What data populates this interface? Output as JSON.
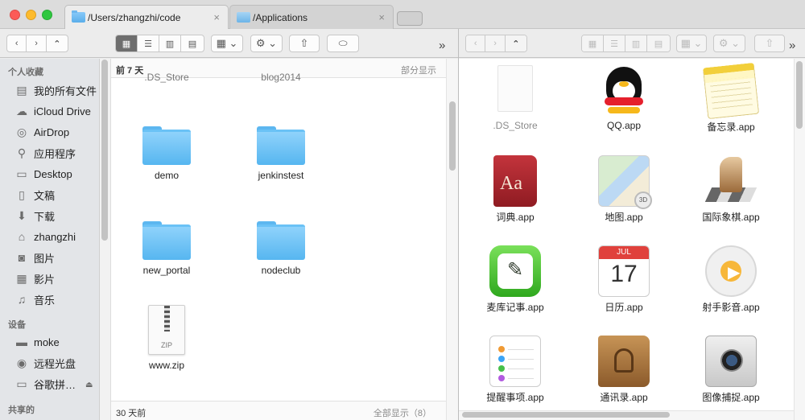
{
  "tabs": [
    {
      "label": "/Users/zhangzhi/code",
      "close": "×"
    },
    {
      "label": "/Applications",
      "close": "×"
    }
  ],
  "toolbar": {
    "back": "‹",
    "forward": "›",
    "up": "⌃",
    "gear": "⚙",
    "share": "⇧",
    "more": "»"
  },
  "sidebar": {
    "favorites_header": "个人收藏",
    "favorites": [
      {
        "icon": "all-files-icon",
        "glyph": "▤",
        "label": "我的所有文件"
      },
      {
        "icon": "cloud-icon",
        "glyph": "☁",
        "label": "iCloud Drive"
      },
      {
        "icon": "airdrop-icon",
        "glyph": "◎",
        "label": "AirDrop"
      },
      {
        "icon": "applications-icon",
        "glyph": "⚲",
        "label": "应用程序"
      },
      {
        "icon": "desktop-icon",
        "glyph": "▭",
        "label": "Desktop"
      },
      {
        "icon": "documents-icon",
        "glyph": "▯",
        "label": "文稿"
      },
      {
        "icon": "download-icon",
        "glyph": "⬇",
        "label": "下载"
      },
      {
        "icon": "home-icon",
        "glyph": "⌂",
        "label": "zhangzhi"
      },
      {
        "icon": "pictures-icon",
        "glyph": "◙",
        "label": "图片"
      },
      {
        "icon": "movies-icon",
        "glyph": "▦",
        "label": "影片"
      },
      {
        "icon": "music-icon",
        "glyph": "♫",
        "label": "音乐"
      }
    ],
    "devices_header": "设备",
    "devices": [
      {
        "icon": "computer-icon",
        "glyph": "▬",
        "label": "moke"
      },
      {
        "icon": "disc-icon",
        "glyph": "◉",
        "label": "远程光盘"
      },
      {
        "icon": "drive-icon",
        "glyph": "▭",
        "label": "谷歌拼…"
      }
    ],
    "eject": "⏏",
    "shared_header": "共享的"
  },
  "left_pane": {
    "header_left": "前 7 天",
    "header_right": "部分显示",
    "footer_left": "30 天前",
    "footer_right": "全部显示（8）",
    "items": [
      {
        "name": ".DS_Store",
        "type": "ghost"
      },
      {
        "name": "blog2014",
        "type": "ghost"
      },
      {
        "name": "demo",
        "type": "folder"
      },
      {
        "name": "jenkinstest",
        "type": "folder"
      },
      {
        "name": "new_portal",
        "type": "folder"
      },
      {
        "name": "nodeclub",
        "type": "folder"
      },
      {
        "name": "www.zip",
        "type": "zip",
        "badge": "ZIP"
      }
    ]
  },
  "right_pane": {
    "apps": [
      {
        "name": ".DS_Store",
        "icon": "ds-store-icon"
      },
      {
        "name": "QQ.app",
        "icon": "qq-icon"
      },
      {
        "name": "备忘录.app",
        "icon": "notes-icon"
      },
      {
        "name": "词典.app",
        "icon": "dictionary-icon",
        "glyph": "Aa"
      },
      {
        "name": "地图.app",
        "icon": "maps-icon",
        "glyph": "3D"
      },
      {
        "name": "国际象棋.app",
        "icon": "chess-icon"
      },
      {
        "name": "麦库记事.app",
        "icon": "memo-icon",
        "glyph": "✎"
      },
      {
        "name": "日历.app",
        "icon": "calendar-icon",
        "month": "JUL",
        "day": "17"
      },
      {
        "name": "射手影音.app",
        "icon": "player-icon",
        "glyph": "▶"
      },
      {
        "name": "提醒事项.app",
        "icon": "reminders-icon"
      },
      {
        "name": "通讯录.app",
        "icon": "contacts-icon"
      },
      {
        "name": "图像捕捉.app",
        "icon": "image-capture-icon"
      }
    ]
  },
  "colors": {
    "accent_folder": "#5db7f0",
    "sidebar_bg": "#e3e5e8",
    "toolbar_bg": "#ececec"
  }
}
